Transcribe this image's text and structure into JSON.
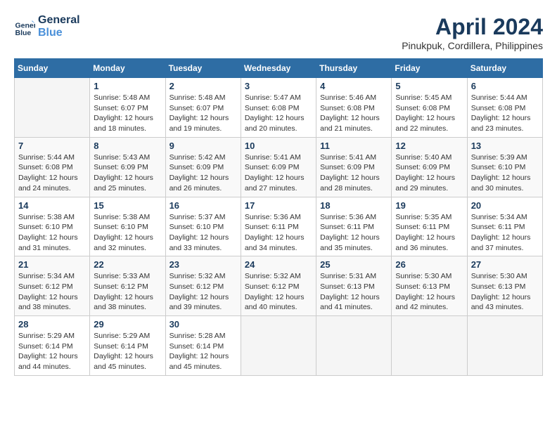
{
  "header": {
    "logo_line1": "General",
    "logo_line2": "Blue",
    "title": "April 2024",
    "location": "Pinukpuk, Cordillera, Philippines"
  },
  "days_of_week": [
    "Sunday",
    "Monday",
    "Tuesday",
    "Wednesday",
    "Thursday",
    "Friday",
    "Saturday"
  ],
  "weeks": [
    [
      {
        "day": "",
        "info": ""
      },
      {
        "day": "1",
        "info": "Sunrise: 5:48 AM\nSunset: 6:07 PM\nDaylight: 12 hours\nand 18 minutes."
      },
      {
        "day": "2",
        "info": "Sunrise: 5:48 AM\nSunset: 6:07 PM\nDaylight: 12 hours\nand 19 minutes."
      },
      {
        "day": "3",
        "info": "Sunrise: 5:47 AM\nSunset: 6:08 PM\nDaylight: 12 hours\nand 20 minutes."
      },
      {
        "day": "4",
        "info": "Sunrise: 5:46 AM\nSunset: 6:08 PM\nDaylight: 12 hours\nand 21 minutes."
      },
      {
        "day": "5",
        "info": "Sunrise: 5:45 AM\nSunset: 6:08 PM\nDaylight: 12 hours\nand 22 minutes."
      },
      {
        "day": "6",
        "info": "Sunrise: 5:44 AM\nSunset: 6:08 PM\nDaylight: 12 hours\nand 23 minutes."
      }
    ],
    [
      {
        "day": "7",
        "info": "Sunrise: 5:44 AM\nSunset: 6:08 PM\nDaylight: 12 hours\nand 24 minutes."
      },
      {
        "day": "8",
        "info": "Sunrise: 5:43 AM\nSunset: 6:09 PM\nDaylight: 12 hours\nand 25 minutes."
      },
      {
        "day": "9",
        "info": "Sunrise: 5:42 AM\nSunset: 6:09 PM\nDaylight: 12 hours\nand 26 minutes."
      },
      {
        "day": "10",
        "info": "Sunrise: 5:41 AM\nSunset: 6:09 PM\nDaylight: 12 hours\nand 27 minutes."
      },
      {
        "day": "11",
        "info": "Sunrise: 5:41 AM\nSunset: 6:09 PM\nDaylight: 12 hours\nand 28 minutes."
      },
      {
        "day": "12",
        "info": "Sunrise: 5:40 AM\nSunset: 6:09 PM\nDaylight: 12 hours\nand 29 minutes."
      },
      {
        "day": "13",
        "info": "Sunrise: 5:39 AM\nSunset: 6:10 PM\nDaylight: 12 hours\nand 30 minutes."
      }
    ],
    [
      {
        "day": "14",
        "info": "Sunrise: 5:38 AM\nSunset: 6:10 PM\nDaylight: 12 hours\nand 31 minutes."
      },
      {
        "day": "15",
        "info": "Sunrise: 5:38 AM\nSunset: 6:10 PM\nDaylight: 12 hours\nand 32 minutes."
      },
      {
        "day": "16",
        "info": "Sunrise: 5:37 AM\nSunset: 6:10 PM\nDaylight: 12 hours\nand 33 minutes."
      },
      {
        "day": "17",
        "info": "Sunrise: 5:36 AM\nSunset: 6:11 PM\nDaylight: 12 hours\nand 34 minutes."
      },
      {
        "day": "18",
        "info": "Sunrise: 5:36 AM\nSunset: 6:11 PM\nDaylight: 12 hours\nand 35 minutes."
      },
      {
        "day": "19",
        "info": "Sunrise: 5:35 AM\nSunset: 6:11 PM\nDaylight: 12 hours\nand 36 minutes."
      },
      {
        "day": "20",
        "info": "Sunrise: 5:34 AM\nSunset: 6:11 PM\nDaylight: 12 hours\nand 37 minutes."
      }
    ],
    [
      {
        "day": "21",
        "info": "Sunrise: 5:34 AM\nSunset: 6:12 PM\nDaylight: 12 hours\nand 38 minutes."
      },
      {
        "day": "22",
        "info": "Sunrise: 5:33 AM\nSunset: 6:12 PM\nDaylight: 12 hours\nand 38 minutes."
      },
      {
        "day": "23",
        "info": "Sunrise: 5:32 AM\nSunset: 6:12 PM\nDaylight: 12 hours\nand 39 minutes."
      },
      {
        "day": "24",
        "info": "Sunrise: 5:32 AM\nSunset: 6:12 PM\nDaylight: 12 hours\nand 40 minutes."
      },
      {
        "day": "25",
        "info": "Sunrise: 5:31 AM\nSunset: 6:13 PM\nDaylight: 12 hours\nand 41 minutes."
      },
      {
        "day": "26",
        "info": "Sunrise: 5:30 AM\nSunset: 6:13 PM\nDaylight: 12 hours\nand 42 minutes."
      },
      {
        "day": "27",
        "info": "Sunrise: 5:30 AM\nSunset: 6:13 PM\nDaylight: 12 hours\nand 43 minutes."
      }
    ],
    [
      {
        "day": "28",
        "info": "Sunrise: 5:29 AM\nSunset: 6:14 PM\nDaylight: 12 hours\nand 44 minutes."
      },
      {
        "day": "29",
        "info": "Sunrise: 5:29 AM\nSunset: 6:14 PM\nDaylight: 12 hours\nand 45 minutes."
      },
      {
        "day": "30",
        "info": "Sunrise: 5:28 AM\nSunset: 6:14 PM\nDaylight: 12 hours\nand 45 minutes."
      },
      {
        "day": "",
        "info": ""
      },
      {
        "day": "",
        "info": ""
      },
      {
        "day": "",
        "info": ""
      },
      {
        "day": "",
        "info": ""
      }
    ]
  ]
}
